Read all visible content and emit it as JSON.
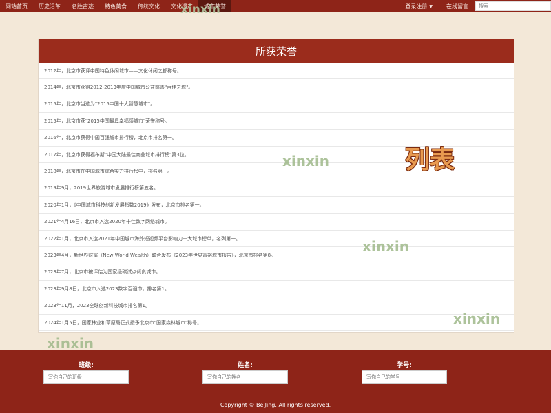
{
  "navbar": {
    "items": [
      "网站首页",
      "历史沿革",
      "名胜古迹",
      "特色美食",
      "传统文化",
      "文化遗产",
      "城市荣誉"
    ],
    "active_index": 6,
    "login_label": "登录注册",
    "message_label": "在线留言",
    "search_placeholder": "搜索"
  },
  "panel": {
    "title": "所获荣誉",
    "rows": [
      "2012年，北京市获评中国特色休闲城市——文化休闲之都称号。",
      "2014年，北京市获得2012-2013年度中国城市公益慈善\"百佳之城\"。",
      "2015年，北京市当选为\"2015中国十大智慧城市\"。",
      "2015年，北京市获\"2015中国最具幸福感城市\"荣誉称号。",
      "2016年，北京市获得中国百强城市排行榜，北京市排名第一。",
      "2017年，北京市获得福布斯\"中国大陆最佳商业城市排行榜\"第3位。",
      "2018年，北京市在中国城市综合实力排行榜中，排名第一。",
      "2019年9月，2019世界旅游城市发展排行榜第五名。",
      "2020年1月，《中国城市科技创新发展指数2019》发布，北京市排名第一。",
      "2021年4月16日，北京市入选2020年十佳数字网络城市。",
      "2022年1月，北京市入选2021年中国城市海外短视频平台影响力十大城市榜单，名列第一。",
      "2023年4月，新世界财富（New World Wealth）联合发布《2023年世界富裕城市报告》，北京市排名第8。",
      "2023年7月，北京市被评估为国家级碳试点优良城市。",
      "2023年9月8日，北京市入选2023数字百强市，排名第1。",
      "2023年11月，2023全球创新科技城市排名第1。",
      "2024年1月5日，国家林业和草原局正式授予北京市\"国家森林城市\"称号。"
    ]
  },
  "watermarks": {
    "text": "xinxin",
    "label": "列表"
  },
  "footer": {
    "fields": [
      {
        "label": "班级:",
        "placeholder": "写你自己的班级"
      },
      {
        "label": "姓名:",
        "placeholder": "写你自己的姓名"
      },
      {
        "label": "学号:",
        "placeholder": "写你自己的学号"
      }
    ],
    "copyright": "Copyright © BeiJing. All rights reserved."
  },
  "colors": {
    "primary": "#8e2418",
    "panel_header": "#9b2c1c",
    "background": "#f3e8d8"
  }
}
